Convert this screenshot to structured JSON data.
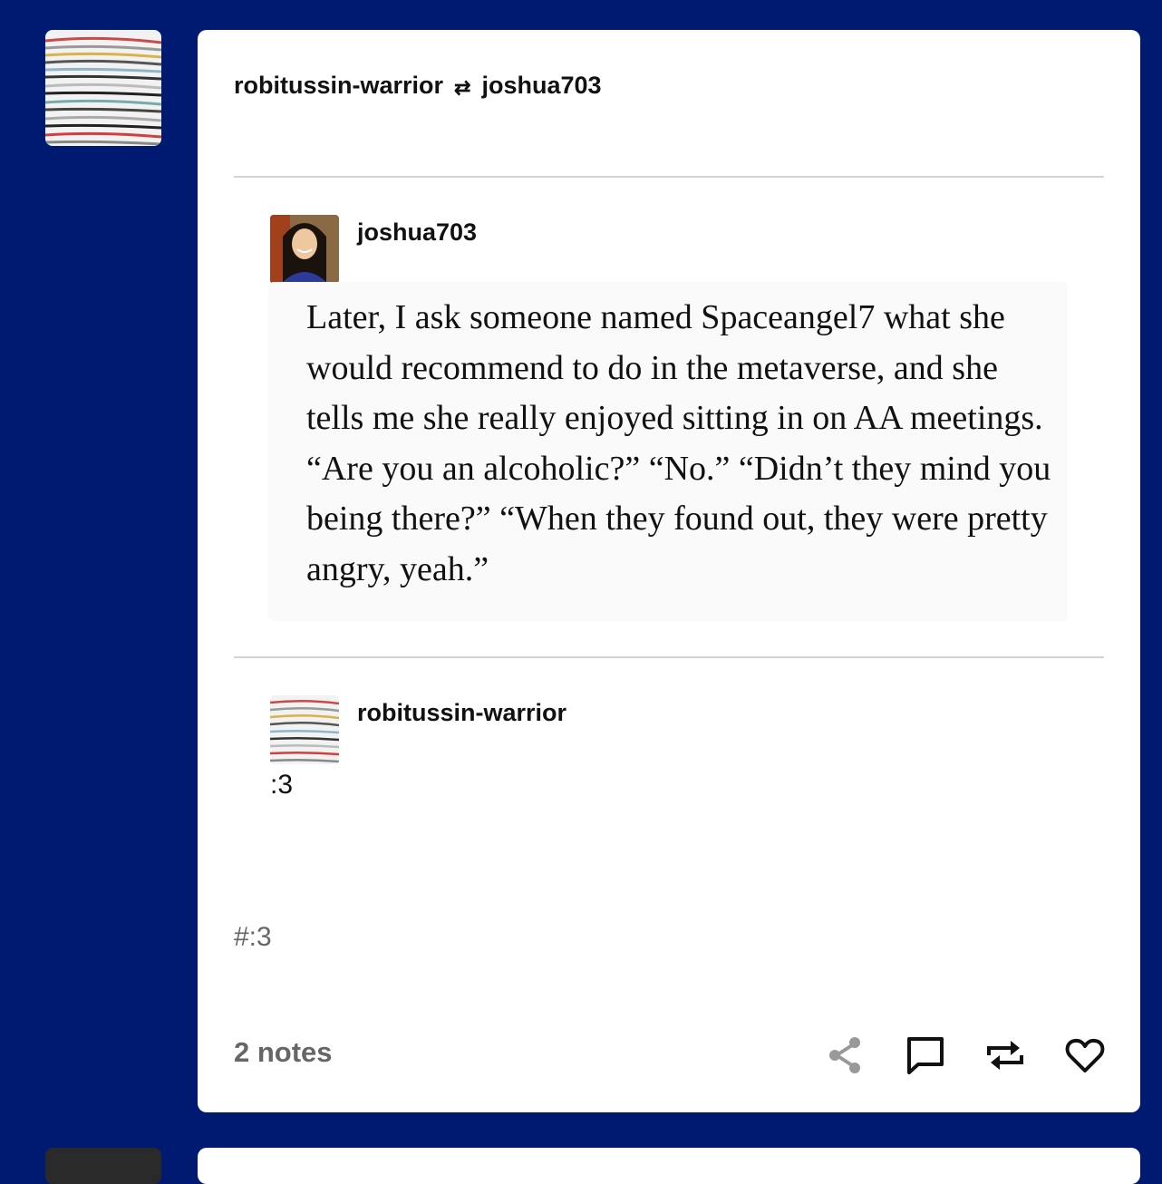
{
  "post": {
    "header": {
      "reblogger": "robitussin-warrior",
      "reblog_glyph": "⇄",
      "source": "joshua703"
    },
    "trail": [
      {
        "username": "joshua703",
        "text": "Later, I ask someone named Spaceangel7 what she would recommend to do in the metaverse, and she tells me she really enjoyed sitting in on AA meetings. “Are you an alcoholic?” “No.” “Didn’t they mind you being there?” “When they found out, they were pretty angry, yeah.”"
      },
      {
        "username": "robitussin-warrior",
        "text": ":3"
      }
    ],
    "tags": [
      "#:3"
    ],
    "notes": "2 notes",
    "actions": [
      "share-icon",
      "reply-icon",
      "reblog-icon",
      "like-icon"
    ]
  },
  "colors": {
    "background": "#001a72",
    "card": "#ffffff",
    "muted_text": "#666666",
    "divider": "#d4d4d4"
  }
}
